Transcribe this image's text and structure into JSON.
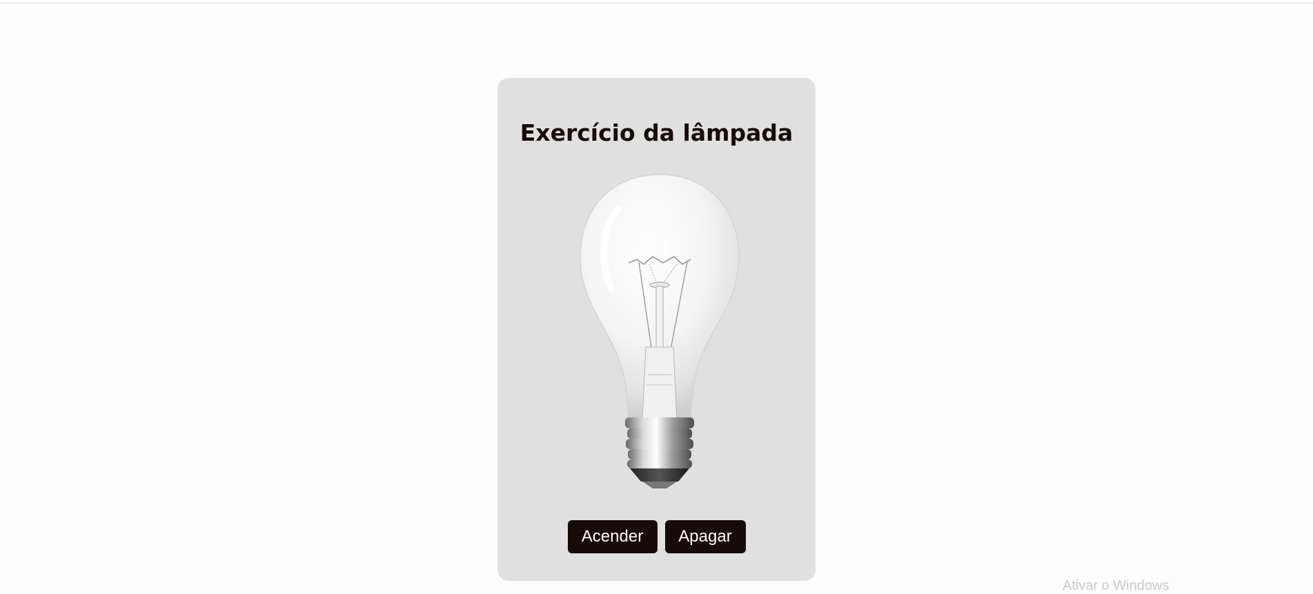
{
  "page": {
    "title": "Exercício da lâmpada"
  },
  "lamp": {
    "icon": "light-bulb-icon",
    "state": "off"
  },
  "buttons": {
    "on_label": "Acender",
    "off_label": "Apagar"
  },
  "watermark": {
    "text": "Ativar o Windows"
  },
  "colors": {
    "background": "#fdfdfd",
    "card": "#e0e0e0",
    "button": "#170b0a",
    "button_text": "#ffffff"
  }
}
